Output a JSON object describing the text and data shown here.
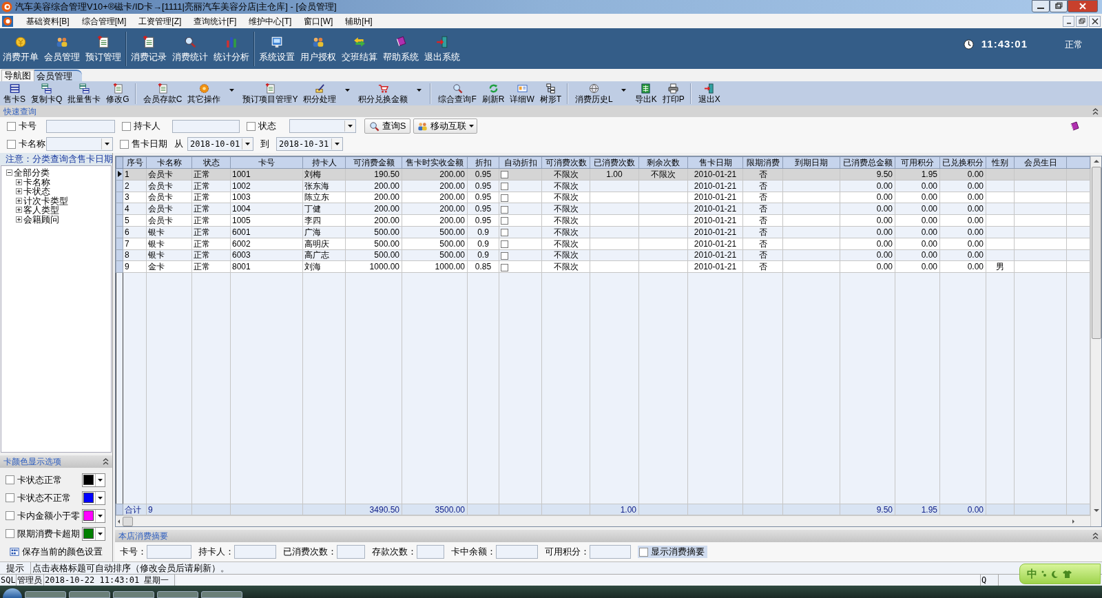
{
  "window": {
    "title": "汽车美容综合管理V10+®磁卡/ID卡→[1111|亮丽汽车美容分店|主仓库] - [会员管理]"
  },
  "menu": [
    "基础资料[B]",
    "综合管理[M]",
    "工资管理[Z]",
    "查询统计[F]",
    "维护中心[T]",
    "窗口[W]",
    "辅助[H]"
  ],
  "main_toolbar": {
    "groups": [
      [
        "消费开单",
        "会员管理",
        "预订管理"
      ],
      [
        "消费记录",
        "消费统计",
        "统计分析"
      ],
      [
        "系统设置",
        "用户授权",
        "交班结算",
        "帮助系统",
        "退出系统"
      ]
    ],
    "clock": "11:43:01",
    "mode": "正常"
  },
  "tabs": [
    {
      "label": "导航图",
      "selected": false
    },
    {
      "label": "会员管理",
      "selected": true
    }
  ],
  "sub_toolbar": {
    "groups": [
      [
        {
          "label": "售卡S",
          "dropdown": false
        },
        {
          "label": "复制卡Q",
          "dropdown": false
        },
        {
          "label": "批量售卡",
          "dropdown": false
        },
        {
          "label": "修改G",
          "dropdown": false
        }
      ],
      [
        {
          "label": "会员存款C",
          "dropdown": false
        },
        {
          "label": "其它操作",
          "dropdown": true
        },
        {
          "label": "预订项目管理Y",
          "dropdown": false
        },
        {
          "label": "积分处理",
          "dropdown": true
        },
        {
          "label": "积分兑换金额",
          "dropdown": true
        }
      ],
      [
        {
          "label": "综合查询F",
          "dropdown": false
        },
        {
          "label": "刷新R",
          "dropdown": false
        },
        {
          "label": "详细W",
          "dropdown": false
        },
        {
          "label": "树形T",
          "dropdown": false
        }
      ],
      [
        {
          "label": "消费历史L",
          "dropdown": true
        },
        {
          "label": "导出K",
          "dropdown": false
        },
        {
          "label": "打印P",
          "dropdown": false
        }
      ],
      [
        {
          "label": "退出X",
          "dropdown": false
        }
      ]
    ]
  },
  "query": {
    "title": "快速查询",
    "rows": [
      {
        "fields": [
          {
            "kind": "text",
            "label": "卡号",
            "checked": false
          },
          {
            "kind": "text",
            "label": "持卡人",
            "checked": false
          },
          {
            "kind": "select",
            "label": "状态",
            "checked": false
          }
        ],
        "buttons": [
          {
            "label": "查询S",
            "dropdown": false
          },
          {
            "label": "移动互联",
            "dropdown": true
          }
        ]
      },
      {
        "fields": [
          {
            "kind": "select",
            "label": "卡名称",
            "checked": false
          },
          {
            "kind": "date_range",
            "label": "售卡日期",
            "checked": false,
            "from_label": "从",
            "from": "2018-10-01",
            "to_label": "到",
            "to": "2018-10-31"
          }
        ]
      }
    ]
  },
  "category_panel": {
    "note": "注意：分类查询含售卡日期",
    "tree": [
      {
        "label": "全部分类",
        "expanded": true,
        "children": [
          {
            "label": "卡名称",
            "expanded": false
          },
          {
            "label": "卡状态",
            "expanded": false
          },
          {
            "label": "计次卡类型",
            "expanded": false
          },
          {
            "label": "客人类型",
            "expanded": false
          },
          {
            "label": "会籍顾问",
            "expanded": false
          }
        ]
      }
    ]
  },
  "color_options": {
    "title": "卡颜色显示选项",
    "items": [
      {
        "label": "卡状态正常",
        "checked": false,
        "color": "#000000"
      },
      {
        "label": "卡状态不正常",
        "checked": false,
        "color": "#0000ff"
      },
      {
        "label": "卡内金额小于零",
        "checked": false,
        "color": "#ff00ff"
      },
      {
        "label": "限期消费卡超期",
        "checked": false,
        "color": "#008000"
      }
    ],
    "save_button": "保存当前的颜色设置"
  },
  "grid": {
    "columns": [
      "序号",
      "卡名称",
      "状态",
      "卡号",
      "持卡人",
      "可消费金额",
      "售卡时实收金额",
      "折扣",
      "自动折扣",
      "可消费次数",
      "已消费次数",
      "剩余次数",
      "售卡日期",
      "限期消费",
      "到期日期",
      "已消费总金额",
      "可用积分",
      "已兑换积分",
      "性别",
      "会员生日"
    ],
    "rows": [
      {
        "selected": true,
        "no": "1",
        "card_name": "会员卡",
        "status": "正常",
        "card_no": "1001",
        "holder": "刘梅",
        "avail_amount": "190.50",
        "paid_amount": "200.00",
        "discount": "0.95",
        "auto_discount": false,
        "avail_times": "不限次",
        "used_times": "1.00",
        "remain_times": "不限次",
        "sale_date": "2010-01-21",
        "limited": "否",
        "total_spent": "9.50",
        "points": "1.95",
        "redeemed": "0.00"
      },
      {
        "selected": false,
        "no": "2",
        "card_name": "会员卡",
        "status": "正常",
        "card_no": "1002",
        "holder": "张东海",
        "avail_amount": "200.00",
        "paid_amount": "200.00",
        "discount": "0.95",
        "auto_discount": false,
        "avail_times": "不限次",
        "sale_date": "2010-01-21",
        "limited": "否",
        "total_spent": "0.00",
        "points": "0.00",
        "redeemed": "0.00"
      },
      {
        "selected": false,
        "no": "3",
        "card_name": "会员卡",
        "status": "正常",
        "card_no": "1003",
        "holder": "陈立东",
        "avail_amount": "200.00",
        "paid_amount": "200.00",
        "discount": "0.95",
        "auto_discount": false,
        "avail_times": "不限次",
        "sale_date": "2010-01-21",
        "limited": "否",
        "total_spent": "0.00",
        "points": "0.00",
        "redeemed": "0.00"
      },
      {
        "selected": false,
        "no": "4",
        "card_name": "会员卡",
        "status": "正常",
        "card_no": "1004",
        "holder": "丁健",
        "avail_amount": "200.00",
        "paid_amount": "200.00",
        "discount": "0.95",
        "auto_discount": false,
        "avail_times": "不限次",
        "sale_date": "2010-01-21",
        "limited": "否",
        "total_spent": "0.00",
        "points": "0.00",
        "redeemed": "0.00"
      },
      {
        "selected": false,
        "no": "5",
        "card_name": "会员卡",
        "status": "正常",
        "card_no": "1005",
        "holder": "李四",
        "avail_amount": "200.00",
        "paid_amount": "200.00",
        "discount": "0.95",
        "auto_discount": false,
        "avail_times": "不限次",
        "sale_date": "2010-01-21",
        "limited": "否",
        "total_spent": "0.00",
        "points": "0.00",
        "redeemed": "0.00"
      },
      {
        "selected": false,
        "no": "6",
        "card_name": "银卡",
        "status": "正常",
        "card_no": "6001",
        "holder": "广海",
        "avail_amount": "500.00",
        "paid_amount": "500.00",
        "discount": "0.9",
        "auto_discount": false,
        "avail_times": "不限次",
        "sale_date": "2010-01-21",
        "limited": "否",
        "total_spent": "0.00",
        "points": "0.00",
        "redeemed": "0.00"
      },
      {
        "selected": false,
        "no": "7",
        "card_name": "银卡",
        "status": "正常",
        "card_no": "6002",
        "holder": "高明庆",
        "avail_amount": "500.00",
        "paid_amount": "500.00",
        "discount": "0.9",
        "auto_discount": false,
        "avail_times": "不限次",
        "sale_date": "2010-01-21",
        "limited": "否",
        "total_spent": "0.00",
        "points": "0.00",
        "redeemed": "0.00"
      },
      {
        "selected": false,
        "no": "8",
        "card_name": "银卡",
        "status": "正常",
        "card_no": "6003",
        "holder": "高广志",
        "avail_amount": "500.00",
        "paid_amount": "500.00",
        "discount": "0.9",
        "auto_discount": false,
        "avail_times": "不限次",
        "sale_date": "2010-01-21",
        "limited": "否",
        "total_spent": "0.00",
        "points": "0.00",
        "redeemed": "0.00"
      },
      {
        "selected": false,
        "no": "9",
        "card_name": "金卡",
        "status": "正常",
        "card_no": "8001",
        "holder": "刘海",
        "avail_amount": "1000.00",
        "paid_amount": "1000.00",
        "discount": "0.85",
        "auto_discount": false,
        "avail_times": "不限次",
        "sale_date": "2010-01-21",
        "limited": "否",
        "total_spent": "0.00",
        "points": "0.00",
        "redeemed": "0.00",
        "gender": "男"
      }
    ],
    "totals": {
      "no": "合计",
      "card_name": "9",
      "avail_amount": "3490.50",
      "paid_amount": "3500.00",
      "used_times": "1.00",
      "total_spent": "9.50",
      "points": "1.95",
      "redeemed": "0.00"
    }
  },
  "summary": {
    "title": "本店消费摘要",
    "fields": [
      "卡号：",
      "持卡人：",
      "已消费次数：",
      "存款次数：",
      "卡中余额：",
      "可用积分："
    ],
    "show_summary": {
      "label": "显示消费摘要",
      "checked": false
    }
  },
  "hint_bar": {
    "label": "提示",
    "text": "点击表格标题可自动排序（修改会员后请刷新）。"
  },
  "status_bar": [
    "SQL",
    "管理员",
    "2018-10-22 11:43:01 星期一",
    "Q"
  ],
  "ime_bar": {
    "mode": "中"
  }
}
